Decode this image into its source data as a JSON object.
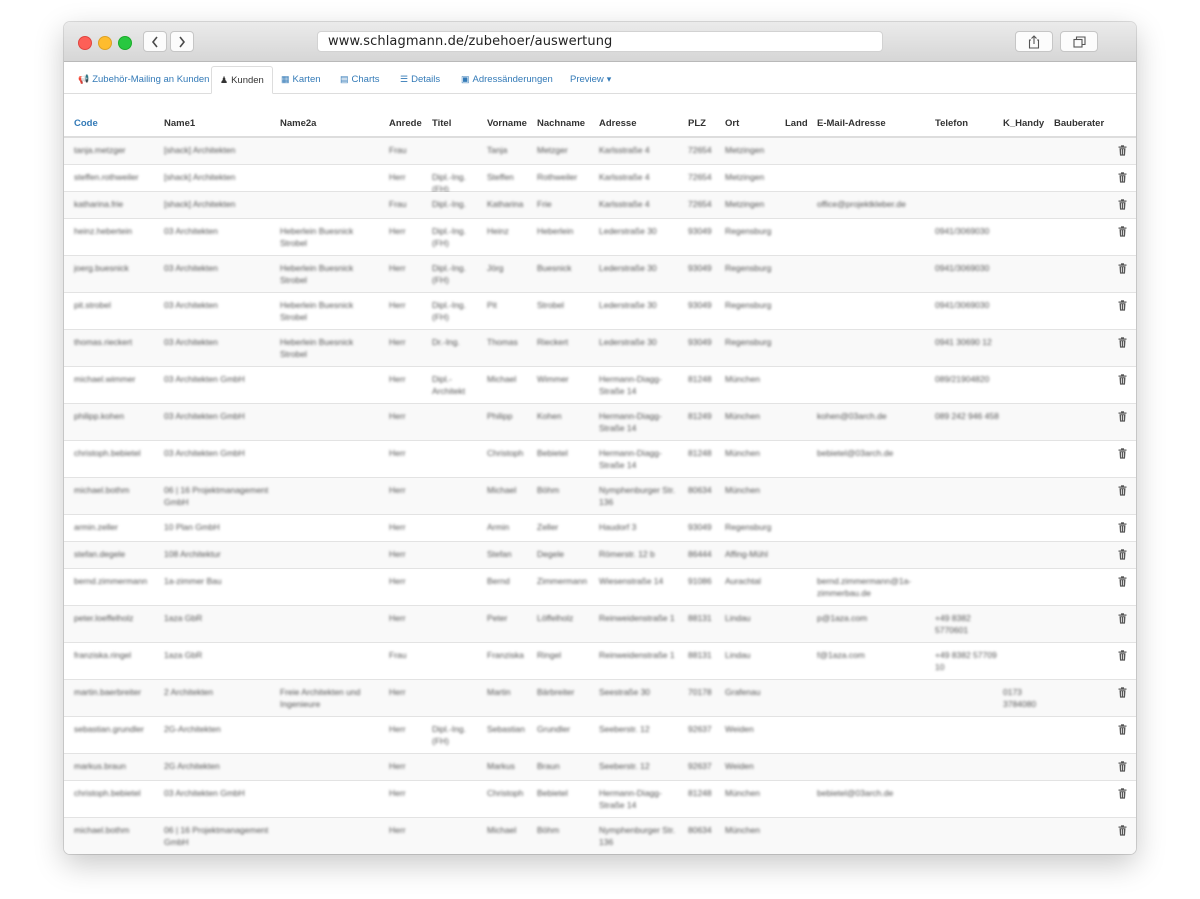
{
  "browser": {
    "url": "www.schlagmann.de/zubehoer/auswertung",
    "back_icon": "chevron-left-icon",
    "forward_icon": "chevron-right-icon",
    "share_icon": "share-icon",
    "tabs_icon": "tabs-icon"
  },
  "tabs": [
    {
      "label": "Zubehör-Mailing an Kunden",
      "icon": "megaphone-icon",
      "active": false
    },
    {
      "label": "Kunden",
      "icon": "user-icon",
      "active": true
    },
    {
      "label": "Karten",
      "icon": "map-icon",
      "active": false
    },
    {
      "label": "Charts",
      "icon": "bar-chart-icon",
      "active": false
    },
    {
      "label": "Details",
      "icon": "list-icon",
      "active": false
    },
    {
      "label": "Adressänderungen",
      "icon": "address-card-icon",
      "active": false
    },
    {
      "label": "Preview",
      "icon": "caret-down-icon",
      "active": false
    }
  ],
  "table": {
    "columns": [
      "Code",
      "Name1",
      "Name2a",
      "Anrede",
      "Titel",
      "Vorname",
      "Nachname",
      "Adresse",
      "PLZ",
      "Ort",
      "Land",
      "E-Mail-Adresse",
      "Telefon",
      "K_Handy",
      "Bauberater"
    ],
    "rows": [
      [
        "tanja.metzger",
        "[shack] Architekten",
        "",
        "Frau",
        "",
        "Tanja",
        "Metzger",
        "Karlsstraße 4",
        "72654",
        "Metzingen",
        "",
        "",
        "",
        "",
        ""
      ],
      [
        "steffen.rothweiler",
        "[shack] Architekten",
        "",
        "Herr",
        "Dipl.-Ing. (FH)",
        "Steffen",
        "Rothweiler",
        "Karlsstraße 4",
        "72654",
        "Metzingen",
        "",
        "",
        "",
        "",
        ""
      ],
      [
        "katharina.frie",
        "[shack] Architekten",
        "",
        "Frau",
        "Dipl.-Ing.",
        "Katharina",
        "Frie",
        "Karlsstraße 4",
        "72654",
        "Metzingen",
        "",
        "office@projektkleber.de",
        "",
        "",
        ""
      ],
      [
        "heinz.hebertein",
        "03 Architekten",
        "Heberlein Buesnick Strobel",
        "Herr",
        "Dipl.-Ing. (FH)",
        "Heinz",
        "Heberlein",
        "Lederstraße 30",
        "93049",
        "Regensburg",
        "",
        "",
        "0941/3069030",
        "",
        ""
      ],
      [
        "joerg.buesnick",
        "03 Architekten",
        "Heberlein Buesnick Strobel",
        "Herr",
        "Dipl.-Ing. (FH)",
        "Jörg",
        "Buesnick",
        "Lederstraße 30",
        "93049",
        "Regensburg",
        "",
        "",
        "0941/3069030",
        "",
        ""
      ],
      [
        "pit.strobel",
        "03 Architekten",
        "Heberlein Buesnick Strobel",
        "Herr",
        "Dipl.-Ing. (FH)",
        "Pit",
        "Strobel",
        "Lederstraße 30",
        "93049",
        "Regensburg",
        "",
        "",
        "0941/3069030",
        "",
        ""
      ],
      [
        "thomas.rieckert",
        "03 Architekten",
        "Heberlein Buesnick Strobel",
        "Herr",
        "Dr.-Ing.",
        "Thomas",
        "Rieckert",
        "Lederstraße 30",
        "93049",
        "Regensburg",
        "",
        "",
        "0941 30690 12",
        "",
        ""
      ],
      [
        "michael.wimmer",
        "03 Architekten GmbH",
        "",
        "Herr",
        "Dipl.-Architekt",
        "Michael",
        "Wimmer",
        "Hermann-Diagg-Straße 14",
        "81248",
        "München",
        "",
        "",
        "089/21904820",
        "",
        ""
      ],
      [
        "philipp.kohen",
        "03 Architekten GmbH",
        "",
        "Herr",
        "",
        "Philipp",
        "Kohen",
        "Hermann-Diagg-Straße 14",
        "81249",
        "München",
        "",
        "kohen@03arch.de",
        "089 242 946 458",
        "",
        ""
      ],
      [
        "christoph.bebietel",
        "03 Architekten GmbH",
        "",
        "Herr",
        "",
        "Christoph",
        "Bebietel",
        "Hermann-Diagg-Straße 14",
        "81248",
        "München",
        "",
        "bebietel@03arch.de",
        "",
        "",
        ""
      ],
      [
        "michael.bothm",
        "06 | 16 Projektmanagement GmbH",
        "",
        "Herr",
        "",
        "Michael",
        "Böhm",
        "Nymphenburger Str. 136",
        "80634",
        "München",
        "",
        "",
        "",
        "",
        ""
      ],
      [
        "armin.zeller",
        "10 Plan GmbH",
        "",
        "Herr",
        "",
        "Armin",
        "Zeller",
        "Haudorf 3",
        "93049",
        "Regensburg",
        "",
        "",
        "",
        "",
        ""
      ],
      [
        "stefan.degele",
        "108 Architektur",
        "",
        "Herr",
        "",
        "Stefan",
        "Degele",
        "Römerstr. 12 b",
        "86444",
        "Affing-Mühl",
        "",
        "",
        "",
        "",
        ""
      ],
      [
        "bernd.zimmermann",
        "1a-zimmer Bau",
        "",
        "Herr",
        "",
        "Bernd",
        "Zimmermann",
        "Wiesenstraße 14",
        "91086",
        "Aurachtal",
        "",
        "bernd.zimmermann@1a-zimmerbau.de",
        "",
        "",
        ""
      ],
      [
        "peter.loeffelholz",
        "1aza GbR",
        "",
        "Herr",
        "",
        "Peter",
        "Löffelholz",
        "Reinweidenstraße 1",
        "88131",
        "Lindau",
        "",
        "p@1aza.com",
        "+49 8382 5770601",
        "",
        ""
      ],
      [
        "franziska.ringel",
        "1aza GbR",
        "",
        "Frau",
        "",
        "Franziska",
        "Ringel",
        "Reinweidenstraße 1",
        "88131",
        "Lindau",
        "",
        "f@1aza.com",
        "+49 8382 57709 10",
        "",
        ""
      ],
      [
        "martin.baerbreiter",
        "2 Architekten",
        "Freie Architekten und Ingenieure",
        "Herr",
        "",
        "Martin",
        "Bärbreiter",
        "Seestraße 30",
        "70178",
        "Grafenau",
        "",
        "",
        "",
        "0173 3784080",
        ""
      ],
      [
        "sebastian.grundler",
        "2G-Architekten",
        "",
        "Herr",
        "Dipl.-Ing. (FH)",
        "Sebastian",
        "Grundler",
        "Seeberstr. 12",
        "92637",
        "Weiden",
        "",
        "",
        "",
        "",
        ""
      ],
      [
        "markus.braun",
        "2G Architekten",
        "",
        "Herr",
        "",
        "Markus",
        "Braun",
        "Seeberstr. 12",
        "92637",
        "Weiden",
        "",
        "",
        "",
        "",
        ""
      ],
      [
        "christoph.bebietel",
        "03 Architekten GmbH",
        "",
        "Herr",
        "",
        "Christoph",
        "Bebietel",
        "Hermann-Diagg-Straße 14",
        "81248",
        "München",
        "",
        "bebietel@03arch.de",
        "",
        "",
        ""
      ],
      [
        "michael.bothm",
        "06 | 16 Projektmanagement GmbH",
        "",
        "Herr",
        "",
        "Michael",
        "Böhm",
        "Nymphenburger Str. 136",
        "80634",
        "München",
        "",
        "",
        "",
        "",
        ""
      ]
    ],
    "row_action_icon": "trash-icon"
  }
}
